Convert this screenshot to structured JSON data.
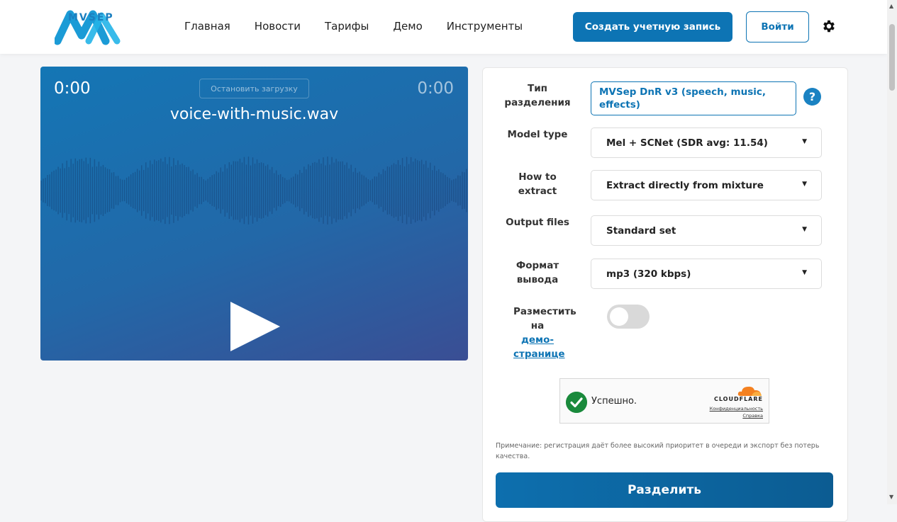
{
  "header": {
    "logo_text": "MVSEP",
    "nav": [
      "Главная",
      "Новости",
      "Тарифы",
      "Демо",
      "Инструменты"
    ],
    "register_label": "Создать учетную запись",
    "login_label": "Войти",
    "settings_icon": "gear-icon"
  },
  "player": {
    "time_current": "0:00",
    "time_total": "0:00",
    "stop_label": "Остановить загрузку",
    "filename": "voice-with-music.wav",
    "play_icon": "play-icon"
  },
  "form": {
    "separation_type": {
      "label": "Тип разделения",
      "value": "MVSep DnR v3 (speech, music, effects)"
    },
    "model_type": {
      "label": "Model type",
      "value": "Mel + SCNet (SDR avg: 11.54)"
    },
    "how_to_extract": {
      "label": "How to extract",
      "value": "Extract directly from mixture"
    },
    "output_files": {
      "label": "Output files",
      "value": "Standard set"
    },
    "output_format": {
      "label": "Формат вывода",
      "value": "mp3 (320 kbps)"
    },
    "demo": {
      "label_pre": "Разместить на",
      "label_link": "демо-странице",
      "enabled": false
    }
  },
  "captcha": {
    "status": "Успешно.",
    "brand": "CLOUDFLARE",
    "privacy": "Конфиденциальность",
    "help": "Справка"
  },
  "note": "Примечание: регистрация даёт более высокий приоритет в очереди и экспорт без потерь качества.",
  "submit_label": "Разделить",
  "colors": {
    "accent": "#0d74b4",
    "player_start": "#1476b5",
    "player_end": "#3a4e94",
    "success": "#1a8a3c"
  }
}
